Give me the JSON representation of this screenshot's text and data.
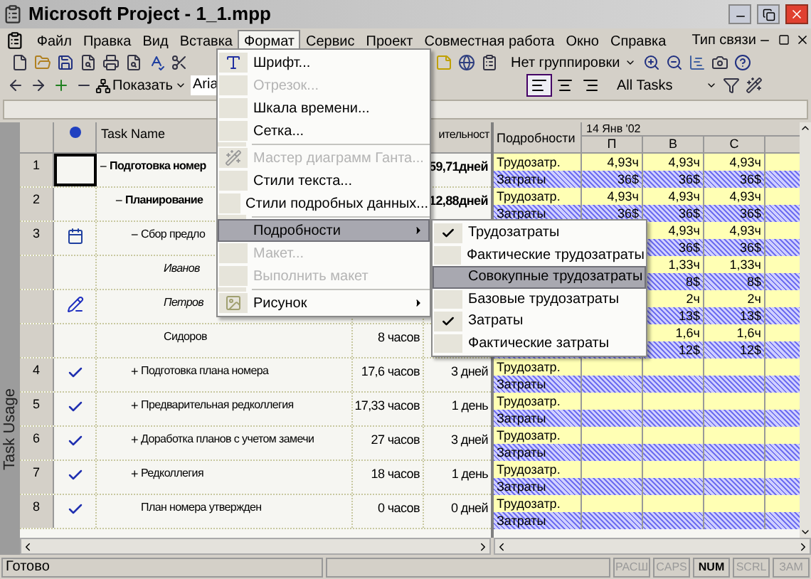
{
  "window": {
    "title": "Microsoft Project - 1_1.mpp"
  },
  "menu_bar": {
    "items": [
      {
        "label": "Файл",
        "selected": false
      },
      {
        "label": "Правка",
        "selected": false
      },
      {
        "label": "Вид",
        "selected": false
      },
      {
        "label": "Вставка",
        "selected": false
      },
      {
        "label": "Формат",
        "selected": true
      },
      {
        "label": "Сервис",
        "selected": false
      },
      {
        "label": "Проект",
        "selected": false
      },
      {
        "label": "Совместная работа",
        "selected": false
      },
      {
        "label": "Окно",
        "selected": false
      },
      {
        "label": "Справка",
        "selected": false
      }
    ],
    "question_box": "Тип связи"
  },
  "standard_toolbar": {
    "grouping": "Нет группировки"
  },
  "formatting_toolbar": {
    "show": "Показать",
    "font": "Aria",
    "alignment": [
      {
        "kind": "left",
        "selected": true
      },
      {
        "kind": "center",
        "selected": false
      },
      {
        "kind": "right",
        "selected": false
      }
    ],
    "filter": "All Tasks"
  },
  "view_bar": {
    "label": "Task Usage"
  },
  "task_table": {
    "columns": {
      "task_name": "Task Name",
      "duration": "ительност"
    },
    "rows": [
      {
        "id": "1",
        "selected": true,
        "kind": "summary",
        "italic": false,
        "outline": "−",
        "name": "Подготовка номер",
        "duration": "59,71дней",
        "details": [
          {
            "kind": "work",
            "label": "Трудозатр.",
            "values": [
              "4,93ч",
              "4,93ч",
              "4,93ч"
            ]
          },
          {
            "kind": "cost",
            "label": "Затраты",
            "values": [
              "36$",
              "36$",
              "36$"
            ]
          }
        ],
        "children": [
          {
            "id": "2",
            "selected": false,
            "kind": "summary",
            "italic": false,
            "outline": "−",
            "name": "Планирование",
            "duration": "12,88дней",
            "details": [
              {
                "kind": "work",
                "label": "Трудозатр.",
                "values": [
                  "4,93ч",
                  "4,93ч",
                  "4,93ч"
                ]
              },
              {
                "kind": "cost",
                "label": "Затраты",
                "values": [
                  "36$",
                  "36$",
                  "36$"
                ]
              }
            ],
            "children": [
              {
                "id": "3",
                "indicator": {
                  "kind": "calendar"
                },
                "selected": false,
                "kind": "task",
                "italic": false,
                "outline": "−",
                "name": "Сбор предло",
                "details": [
                  {
                    "kind": "work",
                    "values": [
                      "4,93ч",
                      "4,93ч"
                    ]
                  },
                  {
                    "kind": "cost",
                    "values": [
                      "36$",
                      "36$"
                    ]
                  }
                ],
                "children": [
                  {
                    "selected": false,
                    "kind": "assignment",
                    "italic": true,
                    "name": "Иванов",
                    "details": [
                      {
                        "kind": "work",
                        "values": [
                          "1,33ч",
                          "1,33ч"
                        ]
                      },
                      {
                        "kind": "cost",
                        "values": [
                          "8$",
                          "8$"
                        ]
                      }
                    ]
                  },
                  {
                    "indicator": {
                      "kind": "edited"
                    },
                    "selected": false,
                    "kind": "assignment",
                    "italic": true,
                    "name": "Петров",
                    "details": [
                      {
                        "kind": "work",
                        "values": [
                          "2ч",
                          "2ч"
                        ]
                      },
                      {
                        "kind": "cost",
                        "values": [
                          "13$",
                          "13$"
                        ]
                      }
                    ]
                  },
                  {
                    "selected": false,
                    "kind": "assignment",
                    "italic": false,
                    "name": "Сидоров",
                    "work": "8 часов",
                    "details": [
                      {
                        "kind": "work",
                        "values": [
                          "1,6ч",
                          "1,6ч"
                        ]
                      },
                      {
                        "kind": "cost",
                        "values": [
                          "12$",
                          "12$"
                        ]
                      }
                    ]
                  }
                ]
              },
              {
                "id": "4",
                "indicator": {
                  "kind": "done"
                },
                "selected": false,
                "kind": "task",
                "italic": false,
                "outline": "+",
                "name": "Подготовка плана номера",
                "work": "17,6 часов",
                "duration": "3 дней",
                "details": [
                  {
                    "kind": "work",
                    "label": "Трудозатр."
                  },
                  {
                    "kind": "cost",
                    "label": "Затраты"
                  }
                ]
              },
              {
                "id": "5",
                "indicator": {
                  "kind": "done"
                },
                "selected": false,
                "kind": "task",
                "italic": false,
                "outline": "+",
                "name": "Предварительная редколлегия",
                "work": "17,33 часов",
                "duration": "1 день",
                "details": [
                  {
                    "kind": "work",
                    "label": "Трудозатр."
                  },
                  {
                    "kind": "cost",
                    "label": "Затраты"
                  }
                ]
              },
              {
                "id": "6",
                "indicator": {
                  "kind": "done"
                },
                "selected": false,
                "kind": "task",
                "italic": false,
                "outline": "+",
                "name": "Доработка планов с учетом замечи",
                "work": "27 часов",
                "duration": "3 дней",
                "details": [
                  {
                    "kind": "work",
                    "label": "Трудозатр."
                  },
                  {
                    "kind": "cost",
                    "label": "Затраты"
                  }
                ]
              },
              {
                "id": "7",
                "indicator": {
                  "kind": "done"
                },
                "selected": false,
                "kind": "task",
                "italic": false,
                "outline": "+",
                "name": "Редколлегия",
                "work": "18 часов",
                "duration": "1 день",
                "details": [
                  {
                    "kind": "work",
                    "label": "Трудозатр."
                  },
                  {
                    "kind": "cost",
                    "label": "Затраты"
                  }
                ]
              },
              {
                "id": "8",
                "indicator": {
                  "kind": "done"
                },
                "selected": false,
                "kind": "task",
                "italic": false,
                "name": "План номера утвержден",
                "work": "0 часов",
                "duration": "0 дней",
                "details": [
                  {
                    "kind": "work",
                    "label": "Трудозатр."
                  },
                  {
                    "kind": "cost",
                    "label": "Затраты"
                  }
                ]
              }
            ]
          }
        ]
      }
    ]
  },
  "usage_grid": {
    "details_column": "Подробности",
    "week": "14 Янв '02",
    "days": [
      "П",
      "В",
      "С"
    ]
  },
  "format_menu": {
    "items": [
      {
        "kind": "item",
        "label": "Шрифт...",
        "disabled": false,
        "selected": false
      },
      {
        "kind": "item",
        "label": "Отрезок...",
        "disabled": true,
        "selected": false
      },
      {
        "kind": "item",
        "label": "Шкала времени...",
        "disabled": false,
        "selected": false
      },
      {
        "kind": "item",
        "label": "Сетка...",
        "disabled": false,
        "selected": false
      },
      {
        "kind": "separator"
      },
      {
        "kind": "item",
        "label": "Мастер диаграмм Ганта...",
        "disabled": true,
        "selected": false
      },
      {
        "kind": "item",
        "label": "Стили текста...",
        "disabled": false,
        "selected": false
      },
      {
        "kind": "item",
        "label": "Стили подробных данных...",
        "disabled": false,
        "selected": false
      },
      {
        "kind": "separator"
      },
      {
        "kind": "submenu",
        "label": "Подробности",
        "disabled": false,
        "selected": true
      },
      {
        "kind": "item",
        "label": "Макет...",
        "disabled": true,
        "selected": false
      },
      {
        "kind": "item",
        "label": "Выполнить макет",
        "disabled": true,
        "selected": false
      },
      {
        "kind": "separator"
      },
      {
        "kind": "submenu",
        "label": "Рисунок",
        "disabled": false,
        "selected": false
      }
    ]
  },
  "details_submenu": {
    "items": [
      {
        "label": "Трудозатраты",
        "checked": true,
        "selected": false
      },
      {
        "label": "Фактические трудозатраты",
        "checked": false,
        "selected": false
      },
      {
        "label": "Совокупные трудозатраты",
        "checked": false,
        "selected": true
      },
      {
        "label": "Базовые трудозатраты",
        "checked": false,
        "selected": false
      },
      {
        "label": "Затраты",
        "checked": true,
        "selected": false
      },
      {
        "label": "Фактические затраты",
        "checked": false,
        "selected": false
      }
    ]
  },
  "status_bar": {
    "message": "Готово",
    "indicators": [
      {
        "label": "РАСШ",
        "on": false
      },
      {
        "label": "CAPS",
        "on": false
      },
      {
        "label": "NUM",
        "on": true
      },
      {
        "label": "SCRL",
        "on": false
      },
      {
        "label": "ЗАМ",
        "on": false
      }
    ]
  }
}
